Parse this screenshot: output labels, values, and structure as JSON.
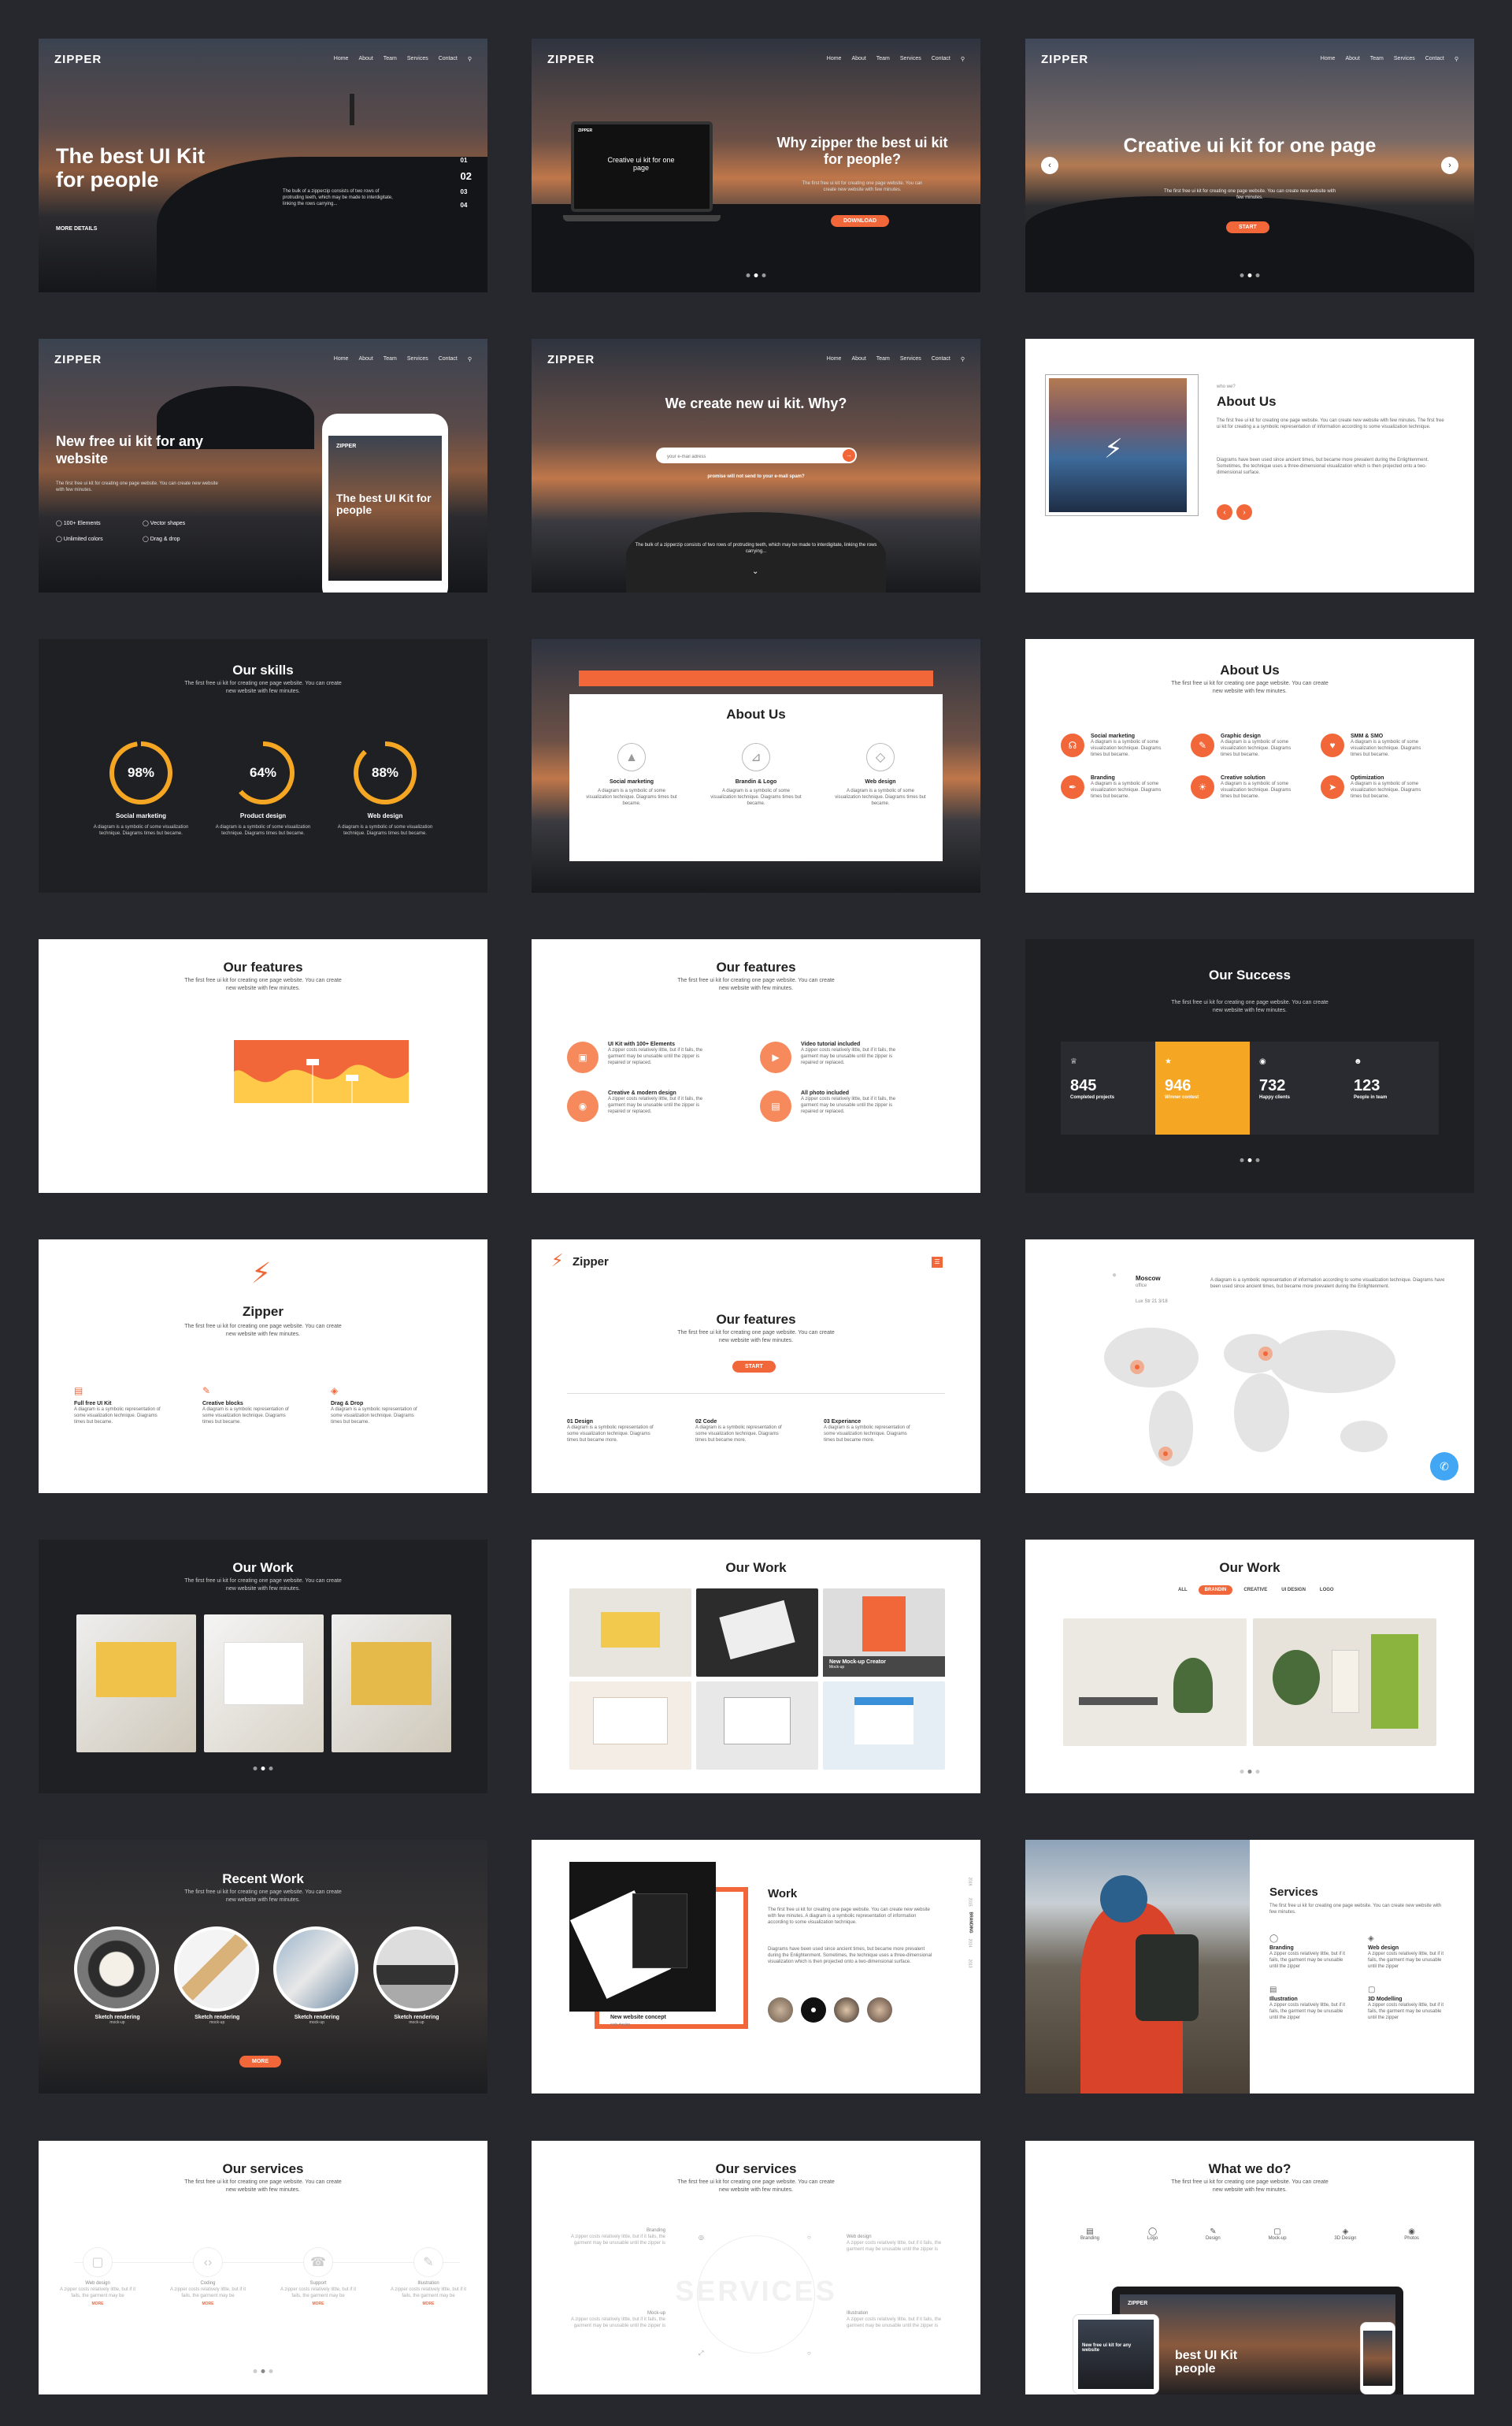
{
  "nav": {
    "items": [
      "Home",
      "About",
      "Team",
      "Services",
      "Contact"
    ]
  },
  "hero1": {
    "logo": "ZIPPER",
    "title": "The best UI Kit for people",
    "text": "The bulk of a zipperzip consists of two rows of protruding teeth, which may be made to interdigitate, linking the rows carrying...",
    "more": "MORE DETAILS",
    "pager": [
      "01",
      "02",
      "03",
      "04"
    ]
  },
  "hero2": {
    "logo": "ZIPPER",
    "title": "Why zipper the best ui kit for people?",
    "text": "The first free ui kit for creating one page website. You can create new website with few minutes.",
    "btn": "DOWNLOAD",
    "screen_logo": "ZIPPER",
    "screen_title": "Creative ui kit for one page"
  },
  "hero3": {
    "logo": "ZIPPER",
    "title": "Creative ui kit for one page",
    "text": "The first free ui kit for creating one page website. You can create new website with few minutes.",
    "btn": "START"
  },
  "hero4": {
    "logo": "ZIPPER",
    "title": "New free ui kit for any website",
    "text": "The first free ui kit for creating one page website. You can create new website with few minutes.",
    "features": [
      "100+ Elements",
      "Vector shapes",
      "Unlimited colors",
      "Drag & drop"
    ],
    "phone_logo": "ZIPPER",
    "phone_title": "The best UI Kit for people"
  },
  "hero5": {
    "logo": "ZIPPER",
    "title": "We create new ui kit. Why?",
    "placeholder": "your e-mail adress",
    "note": "promise will not send to your e-mail spam?",
    "text": "The bulk of a zipperzip consists of two rows of protruding teeth, which may be made to interdigitate, linking the rows carrying..."
  },
  "about1": {
    "kicker": "who we?",
    "title": "About Us",
    "p1": "The first free ui kit for creating one page website. You can create new website with few minutes. The first free ui kit for creating a a symbolic representation of information according to some visualization technique.",
    "p2": "Diagrams have been used since ancient times, but became more prevalent during the Enlightenment. Sometimes, the technique uses a three-dimensional visualization which is then projected onto a two-dimensional surface."
  },
  "skills": {
    "title": "Our skills",
    "sub": "The first free ui kit for creating one page website. You can create new website with few minutes.",
    "items": [
      {
        "pct": "98%",
        "name": "Social marketing",
        "value": 98
      },
      {
        "pct": "64%",
        "name": "Product design",
        "value": 64
      },
      {
        "pct": "88%",
        "name": "Web design",
        "value": 88
      }
    ],
    "desc": "A diagram is a symbolic of some visualization technique. Diagrams times but became."
  },
  "about2": {
    "title": "About Us",
    "items": [
      "Social marketing",
      "Brandin & Logo",
      "Web design"
    ],
    "desc": "A diagram is a symbolic of some visualization technique. Diagrams times but became."
  },
  "about3": {
    "title": "About Us",
    "sub": "The first free ui kit for creating one page website. You can create new website with few minutes.",
    "items": [
      "Social marketing",
      "Graphic design",
      "SMM & SMO",
      "Branding",
      "Creative solution",
      "Optimization"
    ],
    "desc": "A diagram is a symbolic of some visualization technique. Diagrams times but became."
  },
  "feat1": {
    "title": "Our features",
    "sub": "The first free ui kit for creating one page website. You can create new website with few minutes."
  },
  "feat2": {
    "title": "Our features",
    "sub": "The first free ui kit for creating one page website. You can create new website with few minutes.",
    "items": [
      "UI Kit with 100+ Elements",
      "Video tutorial included",
      "Creative & modern design",
      "All photo included"
    ],
    "desc": "A zipper costs relatively little, but if it fails, the garment may be unusable until the zipper is repaired or replaced."
  },
  "success": {
    "title": "Our Success",
    "sub": "The first free ui kit for creating one page website. You can create new website with few minutes.",
    "stats": [
      {
        "n": "845",
        "l": "Completed projects"
      },
      {
        "n": "946",
        "l": "Winner contest"
      },
      {
        "n": "732",
        "l": "Happy clients"
      },
      {
        "n": "123",
        "l": "People in team"
      }
    ]
  },
  "zipper1": {
    "title": "Zipper",
    "sub": "The first free ui kit for creating one page website. You can create new website with few minutes.",
    "items": [
      "Full free UI Kit",
      "Creative blocks",
      "Drag & Drop"
    ],
    "desc": "A diagram is a symbolic representation of some visualization technique. Diagrams times but became."
  },
  "zipper2": {
    "logo": "Zipper",
    "title": "Our features",
    "sub": "The first free ui kit for creating one page website. You can create new website with few minutes.",
    "btn": "START",
    "items": [
      "01 Design",
      "02 Code",
      "03 Experiance"
    ],
    "desc": "A diagram is a symbolic representation of some visualization technique. Diagrams times but became more."
  },
  "map": {
    "city": "Moscow",
    "office": "office",
    "addr": "Lux Str 21 3/18",
    "text": "A diagram is a symbolic representation of information according to some visualization technique. Diagrams have been used since ancient times, but became more prevalent during the Enlightenment."
  },
  "work1": {
    "title": "Our Work",
    "sub": "The first free ui kit for creating one page website. You can create new website with few minutes."
  },
  "work2": {
    "title": "Our Work",
    "caption": "New Mock-up Creator",
    "cap_sub": "Mock-up"
  },
  "work3": {
    "title": "Our Work",
    "filters": [
      "ALL",
      "BRANDIN",
      "CREATIVE",
      "UI DESIGN",
      "LOGO"
    ]
  },
  "recent": {
    "title": "Recent Work",
    "sub": "The first free ui kit for creating one page website. You can create new website with few minutes.",
    "items": [
      "Sketch rendering",
      "Sketch rendering",
      "Sketch rendering",
      "Sketch rendering"
    ],
    "item_sub": "mock-up",
    "btn": "MORE"
  },
  "work4": {
    "title": "Work",
    "p1": "The first free ui kit for creating one page website. You can create new website with few minutes. A diagram is a symbolic representation of information according to some visualization technique.",
    "p2": "Diagrams have been used since ancient times, but became more prevalent during the Enlightenment. Sometimes, the technique uses a three-dimensional visualization which is then projected onto a two-dimensional surface.",
    "caption": "New website concept",
    "cap_sub": "web design",
    "side": [
      "2016",
      "2015",
      "BRANDING",
      "2014",
      "2013"
    ]
  },
  "services1": {
    "title": "Services",
    "sub": "The first free ui kit for creating one page website. You can create new website with few minutes.",
    "items": [
      "Branding",
      "Web design",
      "Illustration",
      "3D Modelling"
    ],
    "desc": "A zipper costs relatively little, but if it fails, the garment may be unusable until the zipper"
  },
  "services2": {
    "title": "Our services",
    "sub": "The first free ui kit for creating one page website. You can create new website with few minutes.",
    "items": [
      "Web design",
      "Coding",
      "Support",
      "Illustration"
    ],
    "desc": "A zipper costs relatively little, but if it fails, the garment may be",
    "more": "MORE"
  },
  "services3": {
    "title": "Our services",
    "sub": "The first free ui kit for creating one page website. You can create new website with few minutes.",
    "watermark": "SERVICES",
    "items": [
      "Branding",
      "Web design",
      "Mock-up",
      "Illustration"
    ],
    "desc": "A zipper costs relatively little, but if it fails, the garment may be unusable until the zipper is"
  },
  "whatwedo": {
    "title": "What we do?",
    "sub": "The first free ui kit for creating one page website. You can create new website with few minutes.",
    "items": [
      "Branding",
      "Logo",
      "Design",
      "Mock-up",
      "3D Design",
      "Photos"
    ],
    "laptop_logo": "ZIPPER",
    "laptop_title": "best UI Kit people",
    "tablet_title": "New free ui kit for any website"
  }
}
